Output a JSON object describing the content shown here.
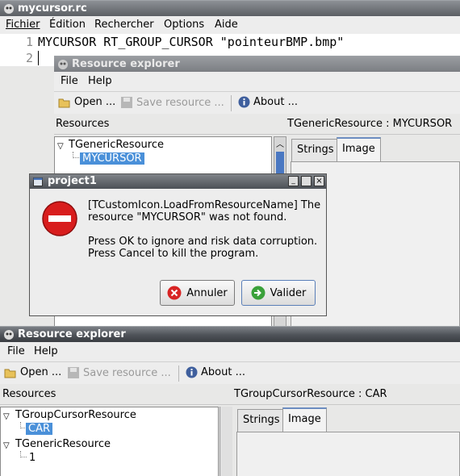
{
  "editor": {
    "title": "mycursor.rc",
    "menu": [
      "Fichier",
      "Édition",
      "Rechercher",
      "Options",
      "Aide"
    ],
    "lines": [
      {
        "num": "1",
        "text": "MYCURSOR RT_GROUP_CURSOR \"pointeurBMP.bmp\""
      },
      {
        "num": "2",
        "text": ""
      }
    ]
  },
  "explorer1": {
    "title": "Resource explorer",
    "menu": [
      "File",
      "Help"
    ],
    "toolbar": {
      "open": "Open ...",
      "save": "Save resource ...",
      "about": "About ..."
    },
    "resources_label": "Resources",
    "detail_label": "TGenericResource : MYCURSOR",
    "tree": {
      "group": "TGenericResource",
      "item": "MYCURSOR"
    },
    "tabs": [
      "Strings",
      "Image"
    ]
  },
  "dialog": {
    "title": "project1",
    "message_line1": "[TCustomIcon.LoadFromResourceName] The",
    "message_line2": "resource \"MYCURSOR\" was not found.",
    "message_line3": "Press OK to ignore and risk data corruption.",
    "message_line4": "Press Cancel to kill the program.",
    "cancel_label": "Annuler",
    "ok_label": "Valider",
    "colors": {
      "error": "#d81d1d",
      "ok": "#3aa13a"
    }
  },
  "explorer2": {
    "title": "Resource explorer",
    "menu": [
      "File",
      "Help"
    ],
    "toolbar": {
      "open": "Open ...",
      "save": "Save resource ...",
      "about": "About ..."
    },
    "resources_label": "Resources",
    "detail_label": "TGroupCursorResource : CAR",
    "tree": [
      {
        "group": "TGroupCursorResource",
        "item": "CAR"
      },
      {
        "group": "TGenericResource",
        "item": "1"
      }
    ],
    "tabs": [
      "Strings",
      "Image"
    ]
  }
}
